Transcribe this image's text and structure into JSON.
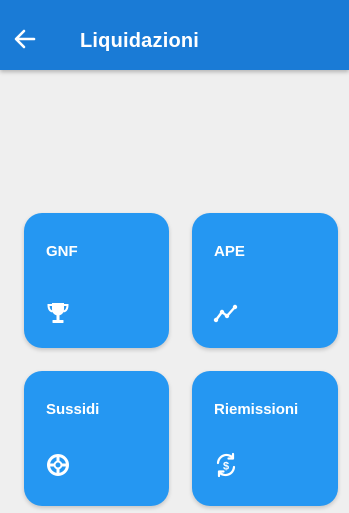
{
  "header": {
    "title": "Liquidazioni",
    "back_icon": "arrow-left-icon",
    "color": "#1a7bd6"
  },
  "tiles": [
    {
      "label": "GNF",
      "icon": "trophy-icon"
    },
    {
      "label": "APE",
      "icon": "trend-line-icon"
    },
    {
      "label": "Sussidi",
      "icon": "lifebuoy-icon"
    },
    {
      "label": "Riemissioni",
      "icon": "currency-exchange-icon"
    }
  ],
  "colors": {
    "background": "#efefef",
    "tile": "#2597f2",
    "text": "#ffffff"
  }
}
